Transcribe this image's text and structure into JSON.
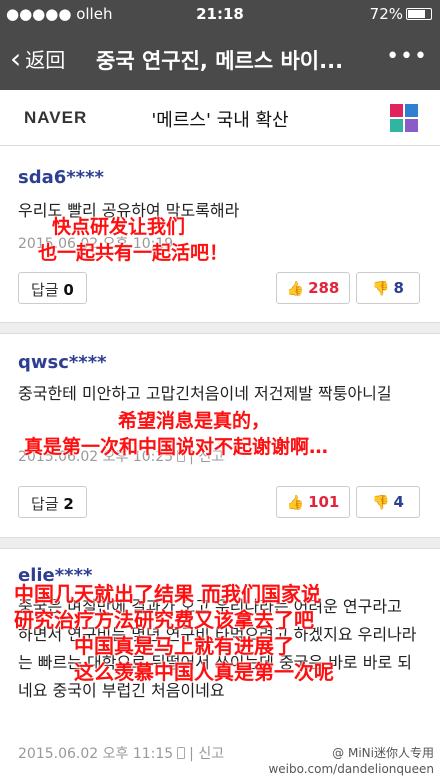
{
  "status_bar": {
    "carrier": "●●●●● olleh",
    "time": "21:18",
    "battery": "72%"
  },
  "nav": {
    "back_label": "返回",
    "title": "중국 연구진, 메르스 바이...",
    "more": "•••"
  },
  "header": {
    "logo": "NAVER",
    "topic": "'메르스' 국내 확산"
  },
  "comments": [
    {
      "username": "sda6****",
      "text": "우리도 빨리 공유하여 막도록해라",
      "meta": "2015.06.02 오후 10:19",
      "reply_label": "답글",
      "reply_count": "0",
      "likes": "288",
      "dislikes": "8"
    },
    {
      "username": "qwsc****",
      "text": "중국한테 미안하고 고맙긴처음이네 저건제발 짝퉁아니길",
      "meta": "2015.06.02 오후 10:25",
      "report": "신고",
      "reply_label": "답글",
      "reply_count": "2",
      "likes": "101",
      "dislikes": "4"
    },
    {
      "username": "elie****",
      "text": "중국은 며칠만에 결과가 오고 우리나라는 어려운 연구라고 하면서 연구비는 몇년 연구비 타먹으려고 하겠지요 우리나라는 빠르는 대학으로 뒤떨어서 쓰이는데 중국은 바로 바로 되네요 중국이 부럽긴 처음이네요",
      "meta": "2015.06.02 오후 11:15",
      "report": "신고"
    }
  ],
  "overlays": {
    "o1_line1": "快点研发让我们",
    "o1_line2": "也一起共有一起活吧！",
    "o2_line1": "希望消息是真的，",
    "o2_line2": "真是第一次和中国说对不起谢谢啊…",
    "o3_line1": "中国几天就出了结果 而我们国家说",
    "o3_line2": "研究治疗方法研究费又该拿去了吧",
    "o3_line3": "中国真是马上就有进展了",
    "o3_line4": "这么羡慕中国人真是第一次呢"
  },
  "watermark": {
    "line1": "@ MiNi迷你人专用",
    "line2": "weibo.com/dandelionqueen"
  },
  "colors": {
    "bar": "#4a4a4a",
    "username": "#2e3f91",
    "like": "#e1263c",
    "overlay": "#ff1010"
  }
}
